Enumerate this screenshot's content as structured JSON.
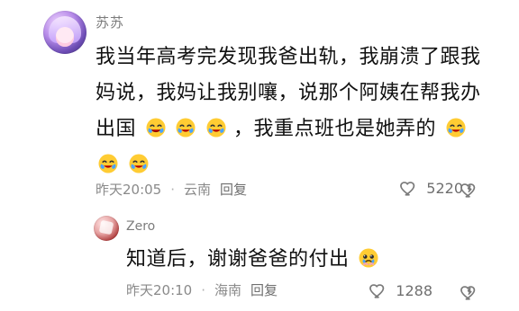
{
  "main_comment": {
    "username": "苏苏",
    "text_line1": "我当年高考完发现我爸出轨，我崩溃了跟我",
    "text_line2": "妈说，我妈让我别嚷，说那个阿姨在帮我办",
    "text_line3_prefix": "出国",
    "text_line3_suffix": "，我重点班也是她弄的",
    "text_line4": "",
    "meta": {
      "time": "昨天20:05",
      "location": "云南",
      "reply_label": "回复",
      "likes": "5220"
    },
    "avatar_icon": "avatar-icon",
    "emoji_icon": "laughing-crying-emoji-icon"
  },
  "reply": {
    "username": "Zero",
    "text": "知道后，谢谢爸爸的付出",
    "meta": {
      "time": "昨天20:10",
      "location": "海南",
      "reply_label": "回复",
      "likes": "1288"
    },
    "avatar_icon": "avatar-icon",
    "emoji_icon": "pleading-face-emoji-icon"
  },
  "colors": {
    "text": "#111111",
    "meta": "#8a8a8a",
    "username": "#7c7c7c"
  },
  "icons": {
    "heart": "heart-icon",
    "dislike": "broken-heart-icon",
    "dot": "dot-separator"
  }
}
